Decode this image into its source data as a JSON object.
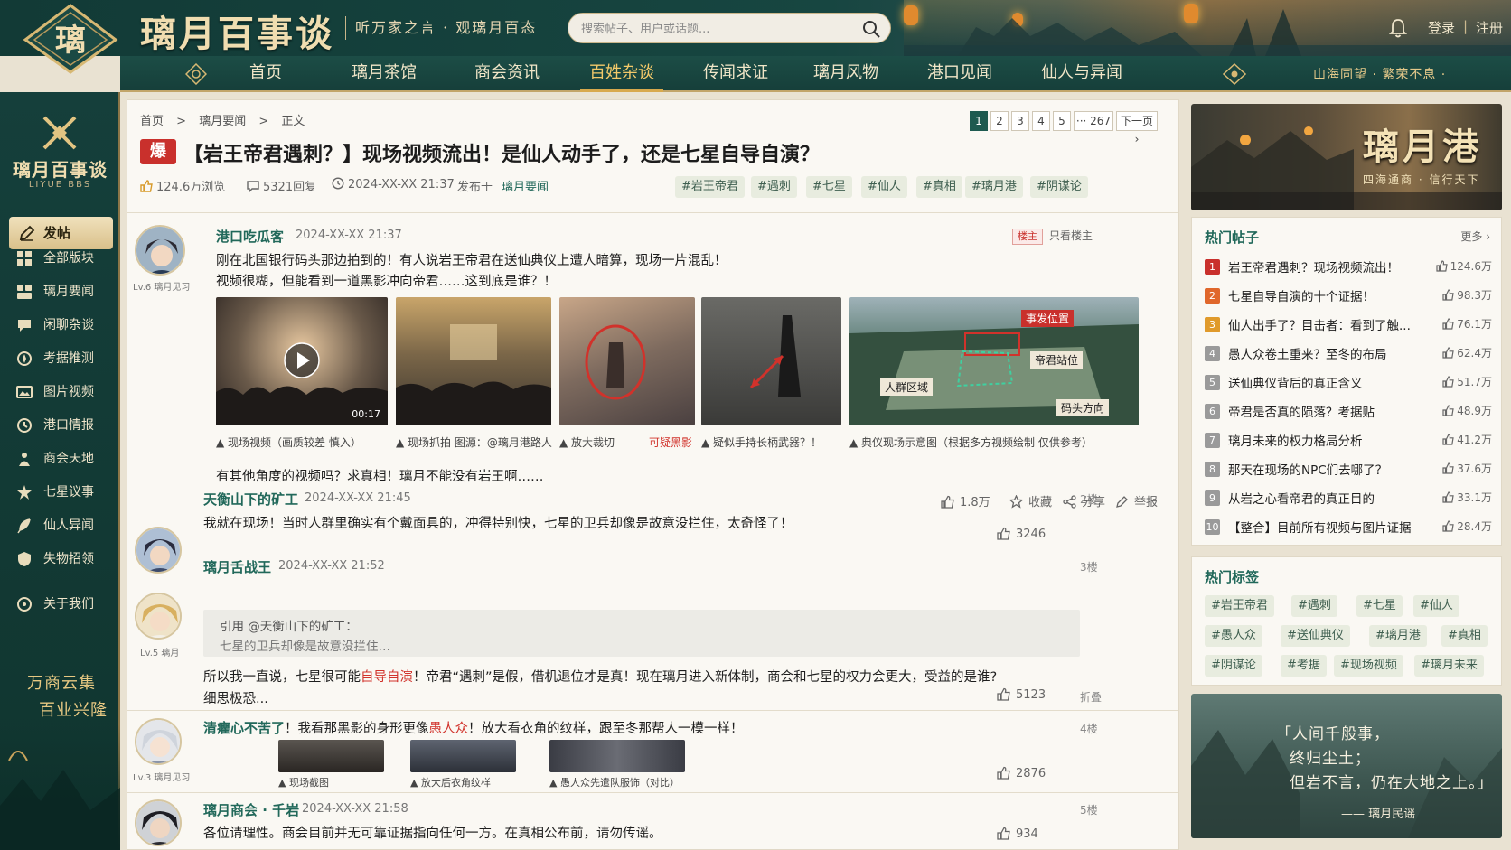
{
  "header": {
    "logo_char": "璃",
    "brand": "璃月百事谈",
    "slogan": "听万家之言 · 观璃月百态",
    "search_placeholder": "搜索帖子、用户或话题...",
    "login": "登录",
    "separator": "|",
    "register": "注册"
  },
  "nav": {
    "items": [
      "首页",
      "璃月茶馆",
      "商会资讯",
      "百姓杂谈",
      "传闻求证",
      "璃月风物",
      "港口见闻",
      "仙人与异闻"
    ],
    "active": "百姓杂谈",
    "motto": "山海同望 · 繁荣不息 ·"
  },
  "sidebar": {
    "title": "璃月百事谈",
    "subtitle": "LIYUE BBS",
    "post_button": "发帖",
    "items": [
      "全部版块",
      "璃月要闻",
      "闲聊杂谈",
      "考据推测",
      "图片视频",
      "港口情报",
      "商会天地",
      "七星议事",
      "仙人异闻",
      "失物招领",
      "关于我们"
    ],
    "art_line1": "万商云集",
    "art_line2": "百业兴隆"
  },
  "post": {
    "breadcrumb": [
      "首页",
      ">",
      "璃月要闻",
      ">",
      "正文"
    ],
    "pager": [
      "1",
      "2",
      "3",
      "4",
      "5",
      "··· 267",
      "下一页 ›"
    ],
    "badge": "爆",
    "title": "【岩王帝君遇刺？】现场视频流出！是仙人动手了，还是七星自导自演？",
    "views": "124.6万浏览",
    "replies": "5321回复",
    "time": "2024-XX-XX 21:37",
    "published_in_label": "发布于",
    "published_in": "璃月要闻",
    "tags": [
      "#岩王帝君",
      "#遇刺",
      "#七星",
      "#仙人",
      "#真相",
      "#璃月港",
      "#阴谋论"
    ]
  },
  "op": {
    "user": "港口吃瓜客",
    "time": "2024-XX-XX 21:37",
    "level": "Lv.6 璃月见习",
    "op_badge": "楼主",
    "only_op": "只看楼主",
    "line1": "刚在北国银行码头那边拍到的！有人说岩王帝君在送仙典仪上遭人暗算，现场一片混乱！",
    "line2": "视频很糊，但能看到一道黑影冲向帝君……这到底是谁？！",
    "video_duration": "00:17",
    "captions": [
      "▲ 现场视频（画质较差  慎入）",
      "▲ 现场抓拍  图源：@璃月港路人",
      "▲ 放大裁切",
      "可疑黑影",
      "▲ 疑似手持长柄武器？！",
      "▲ 典仪现场示意图（根据多方视频绘制  仅供参考）"
    ],
    "map_labels": [
      "事发位置",
      "帝君站位",
      "人群区域",
      "码头方向"
    ],
    "footer_text": "有其他角度的视频吗？求真相！璃月不能没有岩王啊……",
    "likes": "1.8万",
    "collect": "收藏",
    "share": "分享",
    "report": "举报"
  },
  "replies": [
    {
      "user": "天衡山下的矿工",
      "time": "2024-XX-XX 21:45",
      "floor": "2楼",
      "text": "我就在现场！当时人群里确实有个戴面具的，冲得特别快，七星的卫兵却像是故意没拦住，太奇怪了！",
      "likes": "3246"
    },
    {
      "user": "璃月舌战王",
      "time": "2024-XX-XX 21:52",
      "floor": "3楼",
      "level": "Lv.5 璃月",
      "quote_head": "引用 @天衡山下的矿工：",
      "quote_body": "七星的卫兵却像是故意没拦住…",
      "text_a": "所以我一直说，七星很可能",
      "text_red": "自导自演",
      "text_b": "！帝君“遇刺”是假，借机退位才是真！现在璃月进入新体制，商会和七星的权力会更大，受益的是谁?",
      "text_c": "细思极恐...",
      "likes": "5123",
      "collapse": "折叠"
    },
    {
      "user": "清癯心不苦了",
      "floor": "4楼",
      "level": "Lv.3 璃月见习",
      "text_a": "！我看那黑影的身形更像",
      "text_red": "愚人众",
      "text_b": "！放大看衣角的纹样，跟至冬那帮人一模一样！",
      "captions": [
        "▲ 现场截图",
        "▲ 放大后衣角纹样",
        "▲ 愚人众先遣队服饰（对比）"
      ],
      "likes": "2876"
    },
    {
      "user": "璃月商会 · 千岩",
      "time": "2024-XX-XX 21:58",
      "floor": "5楼",
      "text": "各位请理性。商会目前并无可靠证据指向任何一方。在真相公布前，请勿传谣。",
      "likes": "934"
    }
  ],
  "right": {
    "banner_title": "璃月港",
    "banner_sub": "四海通商 · 信行天下",
    "hot_title": "热门帖子",
    "hot_more": "更多 ›",
    "hot_posts": [
      {
        "rank": "1",
        "title": "岩王帝君遇刺？现场视频流出！",
        "likes": "124.6万"
      },
      {
        "rank": "2",
        "title": "七星自导自演的十个证据！",
        "likes": "98.3万"
      },
      {
        "rank": "3",
        "title": "仙人出手了？目击者：看到了触...",
        "likes": "76.1万"
      },
      {
        "rank": "4",
        "title": "愚人众卷土重来？至冬的布局",
        "likes": "62.4万"
      },
      {
        "rank": "5",
        "title": "送仙典仪背后的真正含义",
        "likes": "51.7万"
      },
      {
        "rank": "6",
        "title": "帝君是否真的陨落？考据贴",
        "likes": "48.9万"
      },
      {
        "rank": "7",
        "title": "璃月未来的权力格局分析",
        "likes": "41.2万"
      },
      {
        "rank": "8",
        "title": "那天在现场的NPC们去哪了？",
        "likes": "37.6万"
      },
      {
        "rank": "9",
        "title": "从岩之心看帝君的真正目的",
        "likes": "33.1万"
      },
      {
        "rank": "10",
        "title": "【整合】目前所有视频与图片证据",
        "likes": "28.4万"
      }
    ],
    "rank_colors": [
      "#c9302c",
      "#e0672b",
      "#e09a2b",
      "#9a9a9a",
      "#9a9a9a",
      "#9a9a9a",
      "#9a9a9a",
      "#9a9a9a",
      "#9a9a9a",
      "#9a9a9a"
    ],
    "tags_title": "热门标签",
    "tags": [
      "#岩王帝君",
      "#遇刺",
      "#七星",
      "#仙人",
      "#愚人众",
      "#送仙典仪",
      "#璃月港",
      "#真相",
      "#阴谋论",
      "#考据",
      "#现场视频",
      "#璃月未来"
    ],
    "quote_lines": [
      "「人间千般事，",
      "终归尘土；",
      "但岩不言，仍在大地之上。」"
    ],
    "quote_source": "—— 璃月民谣"
  }
}
